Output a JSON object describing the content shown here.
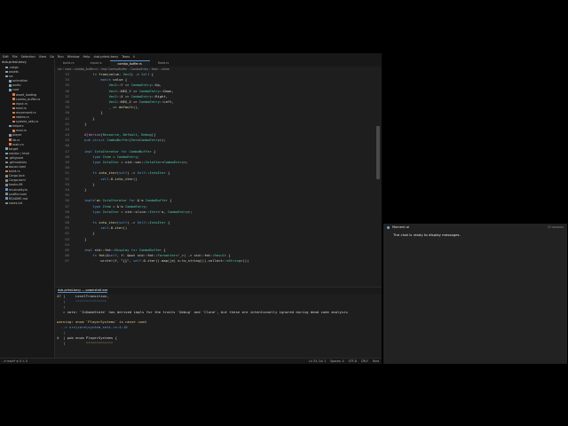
{
  "menubar": {
    "items": [
      "Edit",
      "File",
      "Selection",
      "View",
      "Go",
      "Run",
      "Window",
      "Help",
      "dub-priest-bevy",
      "Tears",
      "ii"
    ]
  },
  "sidebar": {
    "title": "dub-priest-bevy",
    "items": [
      {
        "label": ".cargo",
        "color": "#8aa0b8"
      },
      {
        "label": "assets",
        "color": "#8aa0b8"
      },
      {
        "label": "src",
        "color": "#8aa0b8"
      },
      {
        "label": "animation",
        "color": "#8aa0b8"
      },
      {
        "label": "audio",
        "color": "#8aa0b8"
      },
      {
        "label": "core",
        "color": "#8aa0b8"
      },
      {
        "label": "asset_loading",
        "color": "#d87c4a"
      },
      {
        "label": "combo_buffer.rs",
        "color": "#d87c4a"
      },
      {
        "label": "input.rs",
        "color": "#d87c4a"
      },
      {
        "label": "mod.rs",
        "color": "#d87c4a"
      },
      {
        "label": "movement.rs",
        "color": "#d87c4a"
      },
      {
        "label": "states.rs",
        "color": "#d87c4a"
      },
      {
        "label": "system_sets.rs",
        "color": "#d87c4a"
      },
      {
        "label": "helpers",
        "color": "#8aa0b8"
      },
      {
        "label": "mod.rs",
        "color": "#d87c4a"
      },
      {
        "label": "player",
        "color": "#8aa0b8"
      },
      {
        "label": "lib.rs",
        "color": "#d87c4a"
      },
      {
        "label": "main.rs",
        "color": "#d87c4a"
      },
      {
        "label": "target",
        "color": "#8aa0b8"
      },
      {
        "label": "vendor / level",
        "color": "#8aa0b8"
      },
      {
        "label": ".gitignore",
        "color": "#8a8a8a"
      },
      {
        "label": ".gitmodules",
        "color": "#8a8a8a"
      },
      {
        "label": "bacon.toml",
        "color": "#8a8a8a"
      },
      {
        "label": "build.rs",
        "color": "#d87c4a"
      },
      {
        "label": "Cargo.lock",
        "color": "#8a8a8a"
      },
      {
        "label": "Cargo.toml",
        "color": "#8a8a8a"
      },
      {
        "label": "hooks.lift",
        "color": "#8a8a8a"
      },
      {
        "label": "musicality.ts",
        "color": "#5a9ad8"
      },
      {
        "label": "justfile.toml",
        "color": "#8a8a8a"
      },
      {
        "label": "README.md",
        "color": "#5a9ad8"
      },
      {
        "label": "notes.txt",
        "color": "#8a8a8a"
      }
    ]
  },
  "tabs": [
    {
      "label": "build.rs",
      "active": false
    },
    {
      "label": "input.rs",
      "active": false
    },
    {
      "label": "combo_buffer.rs",
      "active": true
    },
    {
      "label": "fixed.rs",
      "active": false
    }
  ],
  "breadcrumb": "src › core › combo_buffer.rs › impl ComboBuffer › ComboEntry › from › value",
  "code": [
    {
      "n": "33",
      "t": "        fn from(value: Vec2) -> Self {"
    },
    {
      "n": "34",
      "t": "            match value {"
    },
    {
      "n": "35",
      "t": "                Vec2::Y => ComboEntry::Up,"
    },
    {
      "n": "36",
      "t": "                Vec2::NEG_Y => ComboEntry::Down,"
    },
    {
      "n": "37",
      "t": "                Vec2::X => ComboEntry::Right,"
    },
    {
      "n": "38",
      "t": "                Vec2::NEG_X => ComboEntry::Left,"
    },
    {
      "n": "39",
      "t": "                _ => default(),"
    },
    {
      "n": "40",
      "t": "            }"
    },
    {
      "n": "41",
      "t": "        }"
    },
    {
      "n": "42",
      "t": "    }"
    },
    {
      "n": "43",
      "t": ""
    },
    {
      "n": "44",
      "t": "    #[derive(Resource, Default, Debug)]"
    },
    {
      "n": "45",
      "t": "    pub struct ComboBuffer(Vec<ComboEntry>);"
    },
    {
      "n": "46",
      "t": ""
    },
    {
      "n": "47",
      "t": "    impl IntoIterator for ComboBuffer {"
    },
    {
      "n": "48",
      "t": "        type Item = ComboEntry;"
    },
    {
      "n": "49",
      "t": "        type IntoIter = std::vec::IntoIter<ComboEntry>;"
    },
    {
      "n": "50",
      "t": ""
    },
    {
      "n": "51",
      "t": "        fn into_iter(self) -> Self::IntoIter {"
    },
    {
      "n": "52",
      "t": "            self.0.into_iter()"
    },
    {
      "n": "53",
      "t": "        }"
    },
    {
      "n": "54",
      "t": "    }"
    },
    {
      "n": "55",
      "t": ""
    },
    {
      "n": "56",
      "t": "    impl<'a> IntoIterator for &'a ComboBuffer {"
    },
    {
      "n": "57",
      "t": "        type Item = &'a ComboEntry;"
    },
    {
      "n": "58",
      "t": "        type IntoIter = std::slice::Iter<'a, ComboEntry>;"
    },
    {
      "n": "59",
      "t": ""
    },
    {
      "n": "60",
      "t": "        fn into_iter(self) -> Self::IntoIter {"
    },
    {
      "n": "61",
      "t": "            self.0.iter()"
    },
    {
      "n": "62",
      "t": "        }"
    },
    {
      "n": "63",
      "t": "    }"
    },
    {
      "n": "64",
      "t": ""
    },
    {
      "n": "65",
      "t": "    impl std::fmt::Display for ComboBuffer {"
    },
    {
      "n": "66",
      "t": "        fn fmt(&self, f: &mut std::fmt::Formatter<'_>) -> std::fmt::Result {"
    },
    {
      "n": "67",
      "t": "            write!(f, \"{}\", self.0.iter().map(|e| e.to_string()).collect::<String>())"
    }
  ],
  "terminal_tabs": [
    "dub-priest-bevy — powershell.exe"
  ],
  "terminal": [
    {
      "t": "47 |     LevelTransition,",
      "cls": ""
    },
    {
      "t": "   |     ^^^^^^^^^^^^^^^",
      "cls": "c-blue"
    },
    {
      "t": "   |",
      "cls": "c-blue"
    },
    {
      "t": "   = note: `InGameState` has derived impls for the traits `Debug` and `Clone`, but these are intentionally ignored during dead code analysis",
      "cls": ""
    },
    {
      "t": "",
      "cls": ""
    },
    {
      "t": "warning: enum `PlayerSystems` is never used",
      "cls": "c-yellow"
    },
    {
      "t": "  --> src\\core\\system_sets.rs:4:10",
      "cls": "c-blue"
    },
    {
      "t": "   |",
      "cls": "c-blue"
    },
    {
      "t": "4  | pub enum PlayerSystems {",
      "cls": ""
    },
    {
      "t": "   |          ^^^^^^^^^^^^^",
      "cls": "c-yellow"
    },
    {
      "t": "",
      "cls": ""
    },
    {
      "t": "",
      "cls": ""
    },
    {
      "t": "    Building [=====================> ] 539/545: dub-priest-bevy, bevy_pkv, avian2d, bevy_spine, bevy_ecs_tiled",
      "cls": "c-green"
    }
  ],
  "statusbar": {
    "left": "⎇ main*   ⊗ 0  ⚠ 0",
    "right": [
      "Ln 33, Col 1",
      "Spaces: 4",
      "UTF-8",
      "CRLF",
      "Rust"
    ]
  },
  "chat": {
    "sender": "Moment.ai",
    "time": "10 seconds",
    "message": "The chat is ready to display messages."
  }
}
